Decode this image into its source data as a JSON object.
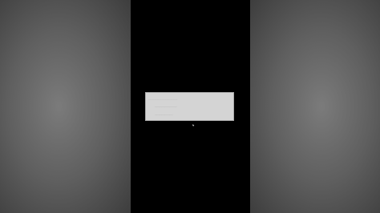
{
  "colors": {
    "background_outer": "#5f5f5f",
    "phone_screen": "#000000",
    "dialog_background": "#d4d4d4",
    "dialog_text": "#8a8a8a",
    "dialog_accent": "#4caf6a"
  },
  "icons": {
    "cursor": "mouse-pointer-icon"
  }
}
